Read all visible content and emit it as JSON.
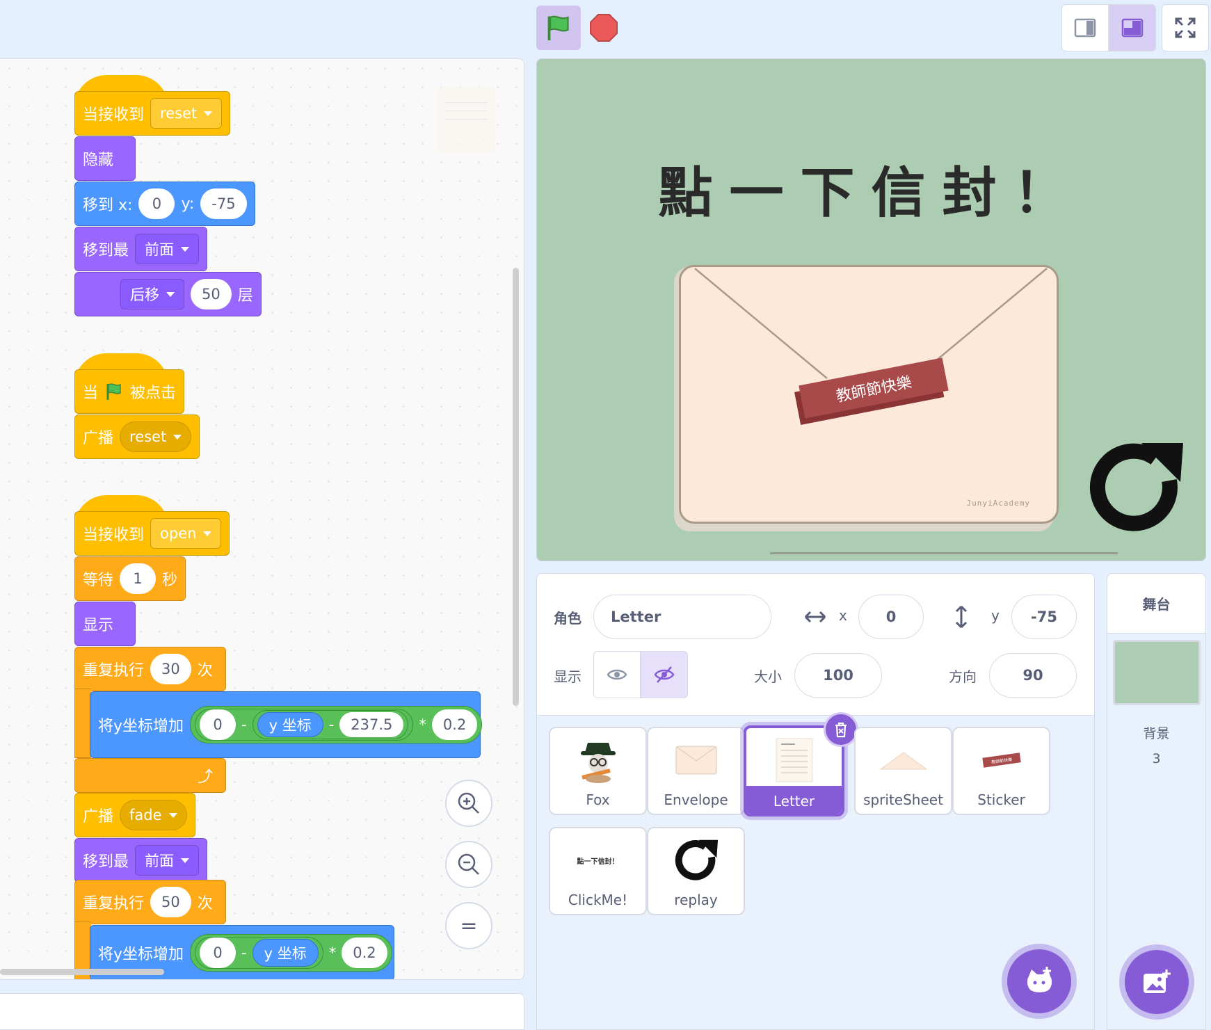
{
  "toolbar": {
    "green_flag": "green-flag-icon",
    "stop": "stop-icon",
    "layout_small": "small-stage-icon",
    "layout_normal": "normal-stage-icon",
    "fullscreen": "fullscreen-icon"
  },
  "scripts": {
    "s1": {
      "hat": "当接收到",
      "msg": "reset",
      "hide": "隐藏",
      "goto": "移到 x:",
      "x": "0",
      "y_label": "y:",
      "y": "-75",
      "layer": "移到最",
      "front": "前面",
      "back": "后移",
      "n": "50",
      "layer_unit": "层"
    },
    "s2": {
      "when": "当",
      "clicked": "被点击",
      "broadcast": "广播",
      "msg": "reset"
    },
    "s3": {
      "hat": "当接收到",
      "msg": "open",
      "wait": "等待",
      "secs": "1",
      "sec_unit": "秒",
      "show": "显示",
      "repeat": "重复执行",
      "times": "30",
      "times_unit": "次",
      "change_y": "将y坐标增加",
      "v0": "0",
      "minus": "-",
      "ypos": "y 坐标",
      "v1": "237.5",
      "mul": "*",
      "v2": "0.2",
      "broadcast": "广播",
      "fade": "fade",
      "layer": "移到最",
      "front": "前面",
      "repeat2": "重复执行",
      "times2": "50",
      "times2_unit": "次",
      "change_y2": "将y坐标增加",
      "w0": "0",
      "minus2": "-",
      "ypos2": "y 坐标",
      "mul2": "*",
      "w2": "0.2"
    }
  },
  "zoom": {
    "in": "zoom-in-icon",
    "out": "zoom-out-icon",
    "reset": "="
  },
  "stage": {
    "title": "點一下信封！",
    "ribbon": "教師節快樂",
    "brand": "JunyiAcademy"
  },
  "sprite_info": {
    "sprite_label": "角色",
    "sprite_name": "Letter",
    "x_label": "x",
    "x": "0",
    "y_label": "y",
    "y": "-75",
    "show_label": "显示",
    "size_label": "大小",
    "size": "100",
    "direction_label": "方向",
    "direction": "90"
  },
  "sprites": [
    {
      "name": "Fox",
      "selected": false
    },
    {
      "name": "Envelope",
      "selected": false
    },
    {
      "name": "Letter",
      "selected": true
    },
    {
      "name": "spriteSheet",
      "selected": false
    },
    {
      "name": "Sticker",
      "selected": false
    },
    {
      "name": "ClickMe!",
      "selected": false
    },
    {
      "name": "replay",
      "selected": false
    }
  ],
  "thumb_text": {
    "clickme": "點一下信封！",
    "sticker": "教師節快樂"
  },
  "stage_panel": {
    "title": "舞台",
    "backdrops_label": "背景",
    "backdrops_count": "3"
  },
  "colors": {
    "events": "#ffbf00",
    "looks": "#9966ff",
    "motion": "#4c97ff",
    "control": "#ffab19",
    "operators": "#59c059",
    "accent": "#855cd6",
    "stage_bg": "#adcdb3"
  }
}
